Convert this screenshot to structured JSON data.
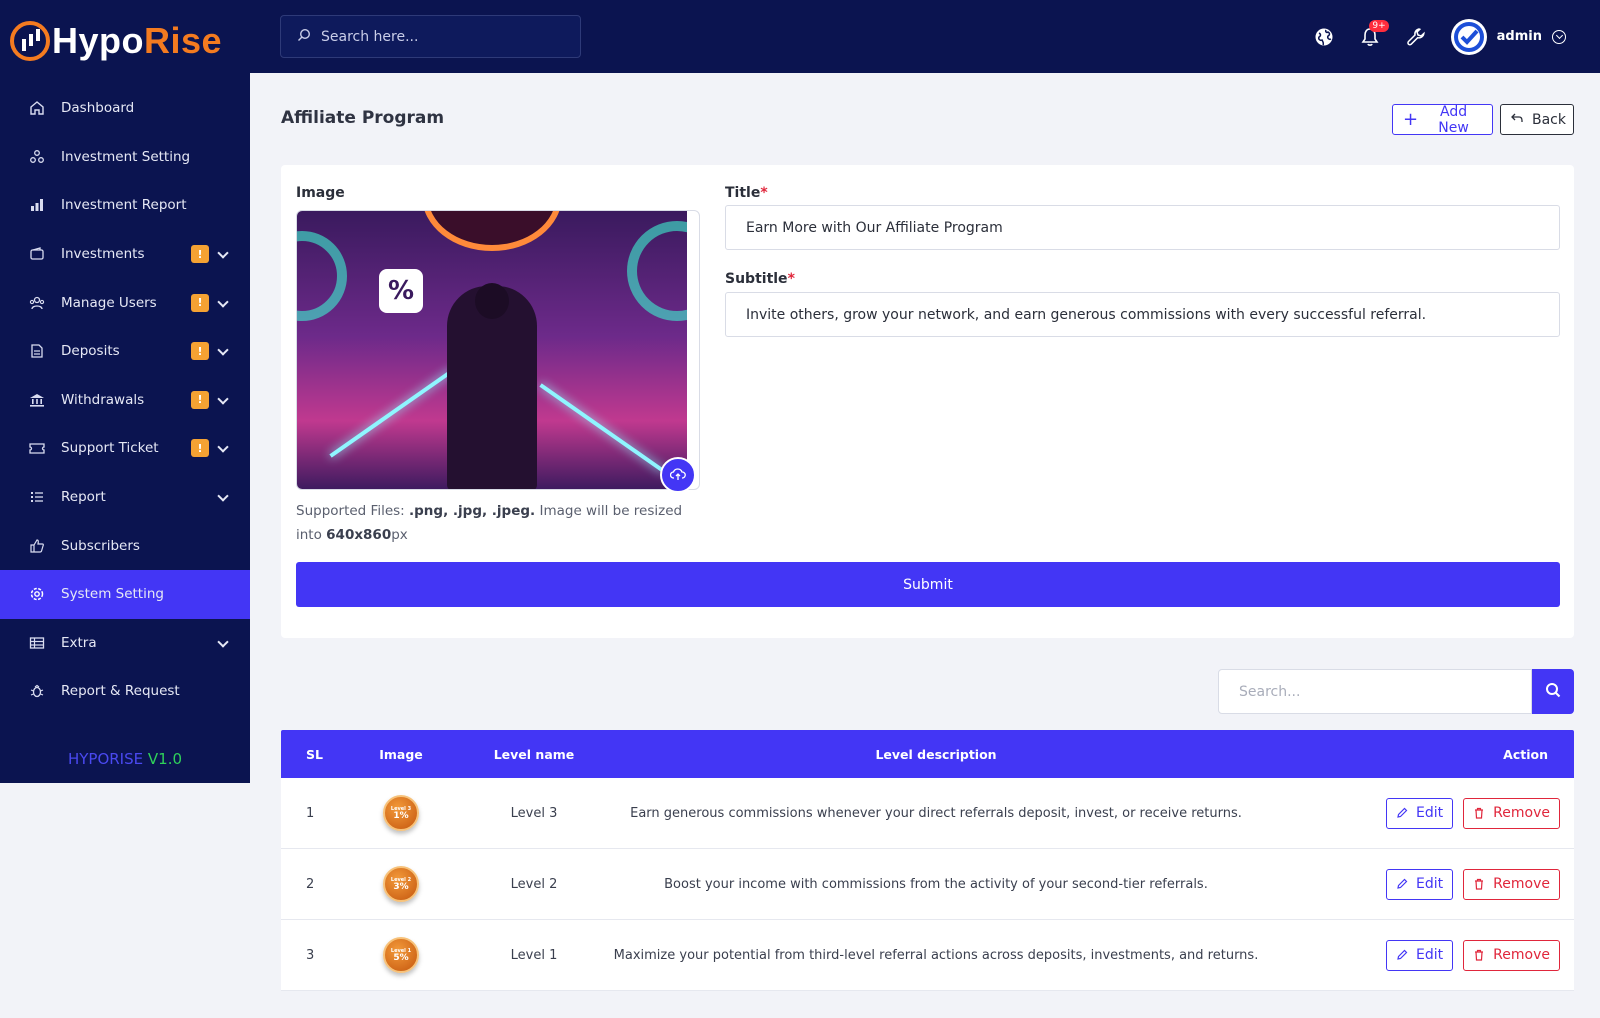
{
  "brand": {
    "part1": "Hypo",
    "part2": "Rise"
  },
  "sidebar": {
    "items": [
      {
        "label": "Dashboard",
        "icon": "home-icon"
      },
      {
        "label": "Investment Setting",
        "icon": "nodes-icon"
      },
      {
        "label": "Investment Report",
        "icon": "bar-chart-icon"
      },
      {
        "label": "Investments",
        "icon": "wallet-icon",
        "badge": "!"
      },
      {
        "label": "Manage Users",
        "icon": "users-icon",
        "badge": "!"
      },
      {
        "label": "Deposits",
        "icon": "document-icon",
        "badge": "!"
      },
      {
        "label": "Withdrawals",
        "icon": "bank-icon",
        "badge": "!"
      },
      {
        "label": "Support Ticket",
        "icon": "ticket-icon",
        "badge": "!"
      },
      {
        "label": "Report",
        "icon": "list-icon"
      },
      {
        "label": "Subscribers",
        "icon": "thumbs-up-icon"
      },
      {
        "label": "System Setting",
        "icon": "gear-icon"
      },
      {
        "label": "Extra",
        "icon": "table-icon"
      },
      {
        "label": "Report & Request",
        "icon": "bug-icon"
      }
    ],
    "version_name": "HYPORISE",
    "version_num": "V1.0"
  },
  "topbar": {
    "search_placeholder": "Search here...",
    "notif_count": "9+",
    "admin_name": "admin"
  },
  "page": {
    "title": "Affiliate Program",
    "add_new_label": "Add New",
    "back_label": "Back"
  },
  "form": {
    "image_label": "Image",
    "title_label": "Title",
    "title_value": "Earn More with Our Affiliate Program",
    "subtitle_label": "Subtitle",
    "subtitle_value": "Invite others, grow your network, and earn generous commissions with every successful referral.",
    "required_mark": "*",
    "help_prefix": "Supported Files: ",
    "help_files": ".png, .jpg, .jpeg.",
    "help_mid": " Image will be resized into ",
    "help_size": "640x860",
    "help_suffix": "px",
    "image_glyph": "%",
    "submit_label": "Submit"
  },
  "table": {
    "search_placeholder": "Search...",
    "headers": {
      "sl": "SL",
      "image": "Image",
      "level_name": "Level name",
      "level_description": "Level description",
      "action": "Action"
    },
    "edit_label": "Edit",
    "remove_label": "Remove",
    "rows": [
      {
        "sl": "1",
        "medal_level": "Level 3",
        "medal_pct": "1%",
        "level_name": "Level 3",
        "description": "Earn generous commissions whenever your direct referrals deposit, invest, or receive returns."
      },
      {
        "sl": "2",
        "medal_level": "Level 2",
        "medal_pct": "3%",
        "level_name": "Level 2",
        "description": "Boost your income with commissions from the activity of your second-tier referrals."
      },
      {
        "sl": "3",
        "medal_level": "Level 1",
        "medal_pct": "5%",
        "level_name": "Level 1",
        "description": "Maximize your potential from third-level referral actions across deposits, investments, and returns."
      }
    ]
  },
  "colors": {
    "navy": "#0b1450",
    "accent": "#4336f5",
    "orange": "#f47b20",
    "danger": "#e0263b",
    "badge": "#f5a233"
  }
}
